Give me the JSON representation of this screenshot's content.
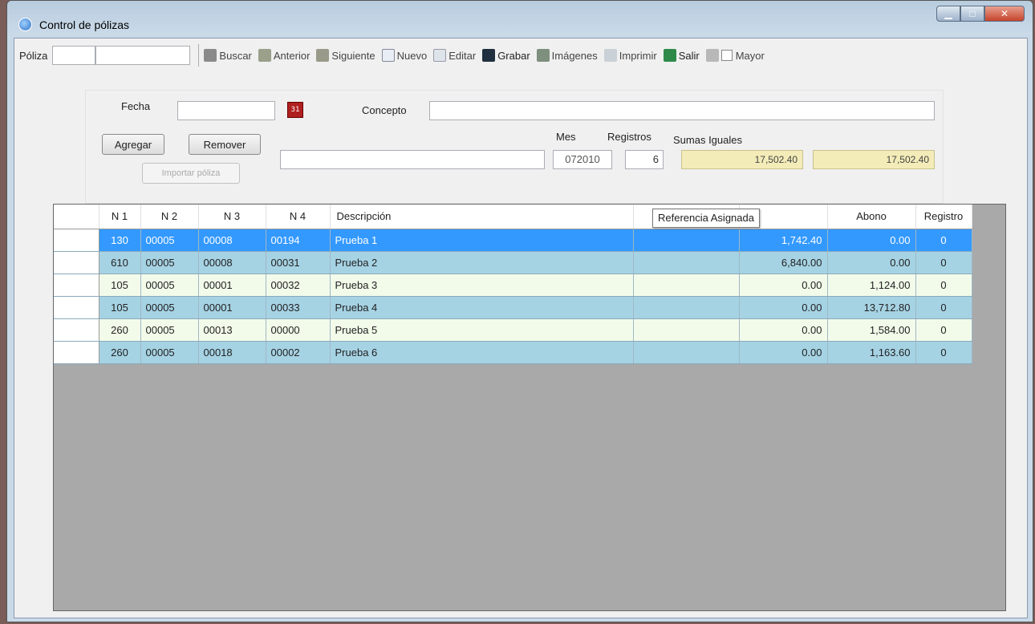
{
  "window": {
    "title": "Control de pólizas"
  },
  "toolbar": {
    "poliza_label": "Póliza",
    "poliza_num_value": "",
    "poliza_desc_value": "",
    "buscar": "Buscar",
    "anterior": "Anterior",
    "siguiente": "Siguiente",
    "nuevo": "Nuevo",
    "editar": "Editar",
    "grabar": "Grabar",
    "imagenes": "Imágenes",
    "imprimir": "Imprimir",
    "salir": "Salir",
    "mayor": "Mayor"
  },
  "form": {
    "fecha_label": "Fecha",
    "fecha_value": "",
    "concepto_label": "Concepto",
    "concepto_value": "",
    "agregar": "Agregar",
    "remover": "Remover",
    "importar": "Importar póliza",
    "referencia_value": "",
    "mes_label": "Mes",
    "mes_value": "072010",
    "registros_label": "Registros",
    "registros_value": "6",
    "sumas_label": "Sumas Iguales",
    "sumas_cargo": "17,502.40",
    "sumas_abono": "17,502.40"
  },
  "grid": {
    "columns": [
      "N 1",
      "N 2",
      "N 3",
      "N 4",
      "Descripción",
      "",
      "",
      "Abono",
      "Registro"
    ],
    "tooltip": "Referencia Asignada",
    "rows": [
      [
        "130",
        "00005",
        "00008",
        "00194",
        "Prueba 1",
        "",
        "1,742.40",
        "0.00",
        "0"
      ],
      [
        "610",
        "00005",
        "00008",
        "00031",
        "Prueba 2",
        "",
        "6,840.00",
        "0.00",
        "0"
      ],
      [
        "105",
        "00005",
        "00001",
        "00032",
        "Prueba 3",
        "",
        "0.00",
        "1,124.00",
        "0"
      ],
      [
        "105",
        "00005",
        "00001",
        "00033",
        "Prueba 4",
        "",
        "0.00",
        "13,712.80",
        "0"
      ],
      [
        "260",
        "00005",
        "00013",
        "00000",
        "Prueba 5",
        "",
        "0.00",
        "1,584.00",
        "0"
      ],
      [
        "260",
        "00005",
        "00018",
        "00002",
        "Prueba 6",
        "",
        "0.00",
        "1,163.60",
        "0"
      ]
    ]
  }
}
